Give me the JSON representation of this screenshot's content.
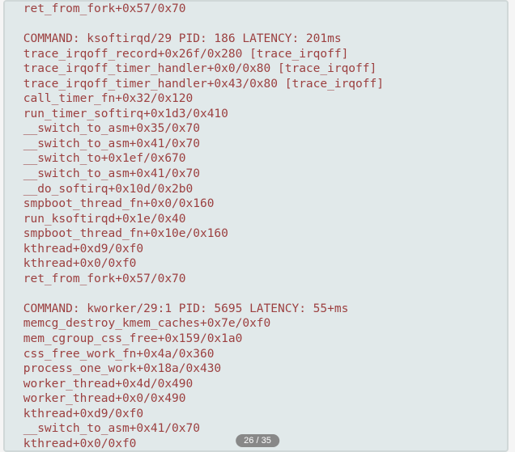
{
  "code_lines": [
    " ret_from_fork+0x57/0x70",
    "",
    " COMMAND: ksoftirqd/29 PID: 186 LATENCY: 201ms",
    " trace_irqoff_record+0x26f/0x280 [trace_irqoff]",
    " trace_irqoff_timer_handler+0x0/0x80 [trace_irqoff]",
    " trace_irqoff_timer_handler+0x43/0x80 [trace_irqoff]",
    " call_timer_fn+0x32/0x120",
    " run_timer_softirq+0x1d3/0x410",
    " __switch_to_asm+0x35/0x70",
    " __switch_to_asm+0x41/0x70",
    " __switch_to+0x1ef/0x670",
    " __switch_to_asm+0x41/0x70",
    " __do_softirq+0x10d/0x2b0",
    " smpboot_thread_fn+0x0/0x160",
    " run_ksoftirqd+0x1e/0x40",
    " smpboot_thread_fn+0x10e/0x160",
    " kthread+0xd9/0xf0",
    " kthread+0x0/0xf0",
    " ret_from_fork+0x57/0x70",
    "",
    " COMMAND: kworker/29:1 PID: 5695 LATENCY: 55+ms",
    " memcg_destroy_kmem_caches+0x7e/0xf0",
    " mem_cgroup_css_free+0x159/0x1a0",
    " css_free_work_fn+0x4a/0x360",
    " process_one_work+0x18a/0x430",
    " worker_thread+0x4d/0x490",
    " worker_thread+0x0/0x490",
    " kthread+0xd9/0xf0",
    " __switch_to_asm+0x41/0x70",
    " kthread+0x0/0xf0"
  ],
  "page_indicator": {
    "current": 26,
    "total": 35,
    "text": "26 / 35"
  }
}
